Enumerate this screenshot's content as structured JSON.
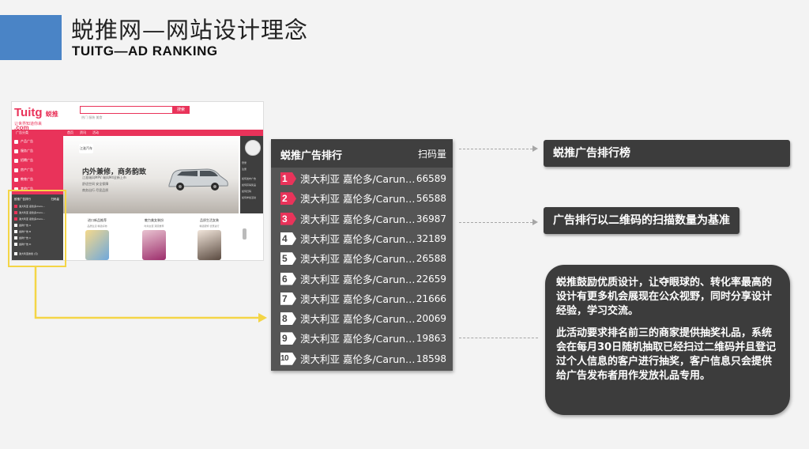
{
  "slide": {
    "title": "蜕推网—网站设计理念",
    "subtitle": "TUITG—AD RANKING",
    "accent_color": "#4a84c6",
    "highlight_color": "#f4d546"
  },
  "thumbnail": {
    "logo_main": "Tuitg",
    "logo_cn": "蜕推",
    "logo_sub": ".com",
    "slogan": "让世界知道你来",
    "search_button": "搜索",
    "hot_words": "热门  服装  美食",
    "nav_items": [
      "广告分类",
      "首页",
      "资讯",
      "活动"
    ],
    "side_items": [
      "产品广告",
      "服务广告",
      "招聘广告",
      "房产广告",
      "教育广告",
      "其他广告"
    ],
    "banner_brand": "江淮汽车",
    "banner_title": "内外兼修，商务韵致",
    "banner_line1": "江淮瑞风MPV 瑞风M4全新上市",
    "banner_line2": "舒适空间  安全保障",
    "banner_line3": "商务出行  尽显品质",
    "right_items": [
      "登录",
      "注册",
      "如何发布广告",
      "如何获得奖品",
      "如何扫码",
      "如何参加活动"
    ],
    "rank_head": "蜕推广告排行",
    "rank_head_col": "扫码量",
    "rank_rows": [
      "澳大利亚 嘉伦多/Caru…",
      "澳大利亚 嘉伦多/Caru…",
      "澳大利亚 嘉伦多/Caru…",
      "金牌广告 A",
      "金牌广告 B",
      "金牌广告 C",
      "金牌广告 D",
      "澳大利亚蜂蜜 (元)"
    ],
    "cards": [
      {
        "title": "进口新品推荐",
        "sub": "品质生活 精选好物"
      },
      {
        "title": "魅力美女装扮",
        "sub": "时尚女装 潮流推荐"
      },
      {
        "title": "品质生活女装",
        "sub": "精选服饰 优惠进行"
      }
    ]
  },
  "ranking": {
    "title": "蜕推广告排行",
    "column": "扫码量",
    "rows": [
      {
        "rank": "1",
        "name": "澳大利亚 嘉伦多/Carun…",
        "count": "66589",
        "top": true
      },
      {
        "rank": "2",
        "name": "澳大利亚 嘉伦多/Carun…",
        "count": "56588",
        "top": true
      },
      {
        "rank": "3",
        "name": "澳大利亚 嘉伦多/Carun…",
        "count": "36987",
        "top": true
      },
      {
        "rank": "4",
        "name": "澳大利亚 嘉伦多/Carun…",
        "count": "32189",
        "top": false
      },
      {
        "rank": "5",
        "name": "澳大利亚 嘉伦多/Carun…",
        "count": "26588",
        "top": false
      },
      {
        "rank": "6",
        "name": "澳大利亚 嘉伦多/Carun…",
        "count": "22659",
        "top": false
      },
      {
        "rank": "7",
        "name": "澳大利亚 嘉伦多/Carun…",
        "count": "21666",
        "top": false
      },
      {
        "rank": "8",
        "name": "澳大利亚 嘉伦多/Carun…",
        "count": "20069",
        "top": false
      },
      {
        "rank": "9",
        "name": "澳大利亚 嘉伦多/Carun…",
        "count": "19863",
        "top": false
      },
      {
        "rank": "10",
        "name": "澳大利亚 嘉伦多/Carun…",
        "count": "18598",
        "top": false
      }
    ]
  },
  "callouts": {
    "first": "蜕推广告排行榜",
    "second": "广告排行以二维码的扫描数量为基准"
  },
  "info": {
    "p1": "蜕推鼓励优质设计，让夺眼球的、转化率最高的设计有更多机会展现在公众视野，同时分享设计经验，学习交流。",
    "p2": "此活动要求排名前三的商家提供抽奖礼品，系统会在每月30日随机抽取已经扫过二维码并且登记过个人信息的客户进行抽奖，客户信息只会提供给广告发布者用作发放礼品专用。"
  }
}
